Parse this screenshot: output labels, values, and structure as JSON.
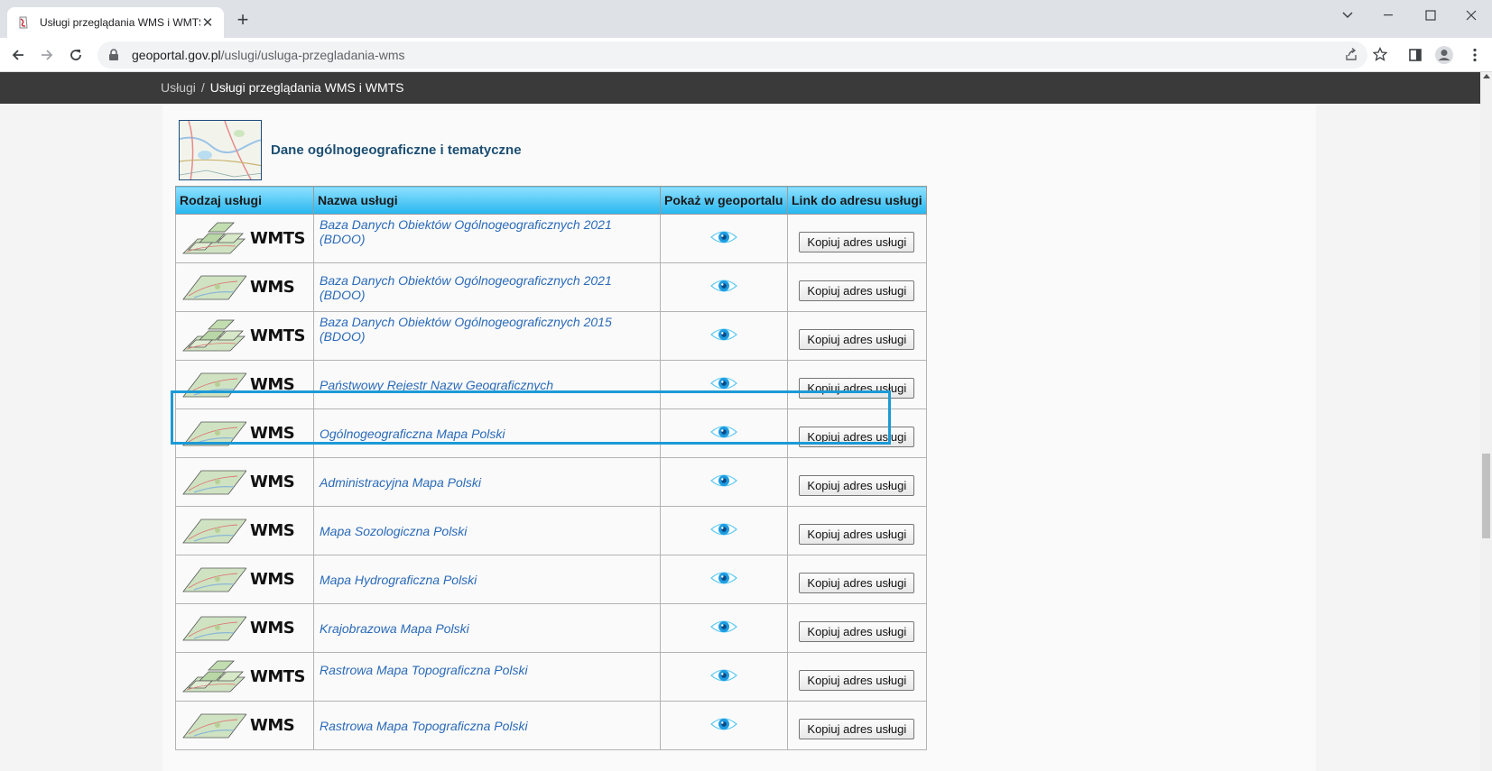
{
  "browser": {
    "tab_title": "Usługi przeglądania WMS i WMTS",
    "url_host": "geoportal.gov.pl",
    "url_path": "/uslugi/usluga-przegladania-wms"
  },
  "breadcrumb": {
    "parent": "Usługi",
    "separator": "/",
    "current": "Usługi przeglądania WMS i WMTS"
  },
  "section": {
    "title": "Dane ogólnogeograficzne i tematyczne"
  },
  "table": {
    "headers": [
      "Rodzaj usługi",
      "Nazwa usługi",
      "Pokaż w geoportalu",
      "Link do adresu usługi"
    ],
    "copy_label": "Kopiuj adres usługi",
    "rows": [
      {
        "type": "WMTS",
        "name": "Baza Danych Obiektów Ogólnogeograficznych 2021 (BDOO)"
      },
      {
        "type": "WMS",
        "name": "Baza Danych Obiektów Ogólnogeograficznych 2021 (BDOO)"
      },
      {
        "type": "WMTS",
        "name": "Baza Danych Obiektów Ogólnogeograficznych 2015 (BDOO)"
      },
      {
        "type": "WMS",
        "name": "Państwowy Rejestr Nazw Geograficznych"
      },
      {
        "type": "WMS",
        "name": "Ogólnogeograficzna Mapa Polski"
      },
      {
        "type": "WMS",
        "name": "Administracyjna Mapa Polski"
      },
      {
        "type": "WMS",
        "name": "Mapa Sozologiczna Polski"
      },
      {
        "type": "WMS",
        "name": "Mapa Hydrograficzna Polski"
      },
      {
        "type": "WMS",
        "name": "Krajobrazowa Mapa Polski"
      },
      {
        "type": "WMTS",
        "name": "Rastrowa Mapa Topograficzna Polski"
      },
      {
        "type": "WMS",
        "name": "Rastrowa Mapa Topograficzna Polski"
      }
    ]
  },
  "colors": {
    "header_gradient_top": "#8fe0ff",
    "header_gradient_bottom": "#27b6ef",
    "link": "#2a6ab8",
    "highlight": "#1c9ad6",
    "breadcrumb_bg": "#3a3a3a"
  },
  "icons": {
    "show": "eye-icon",
    "tab": "favicon-icon",
    "lock": "lock-icon"
  }
}
